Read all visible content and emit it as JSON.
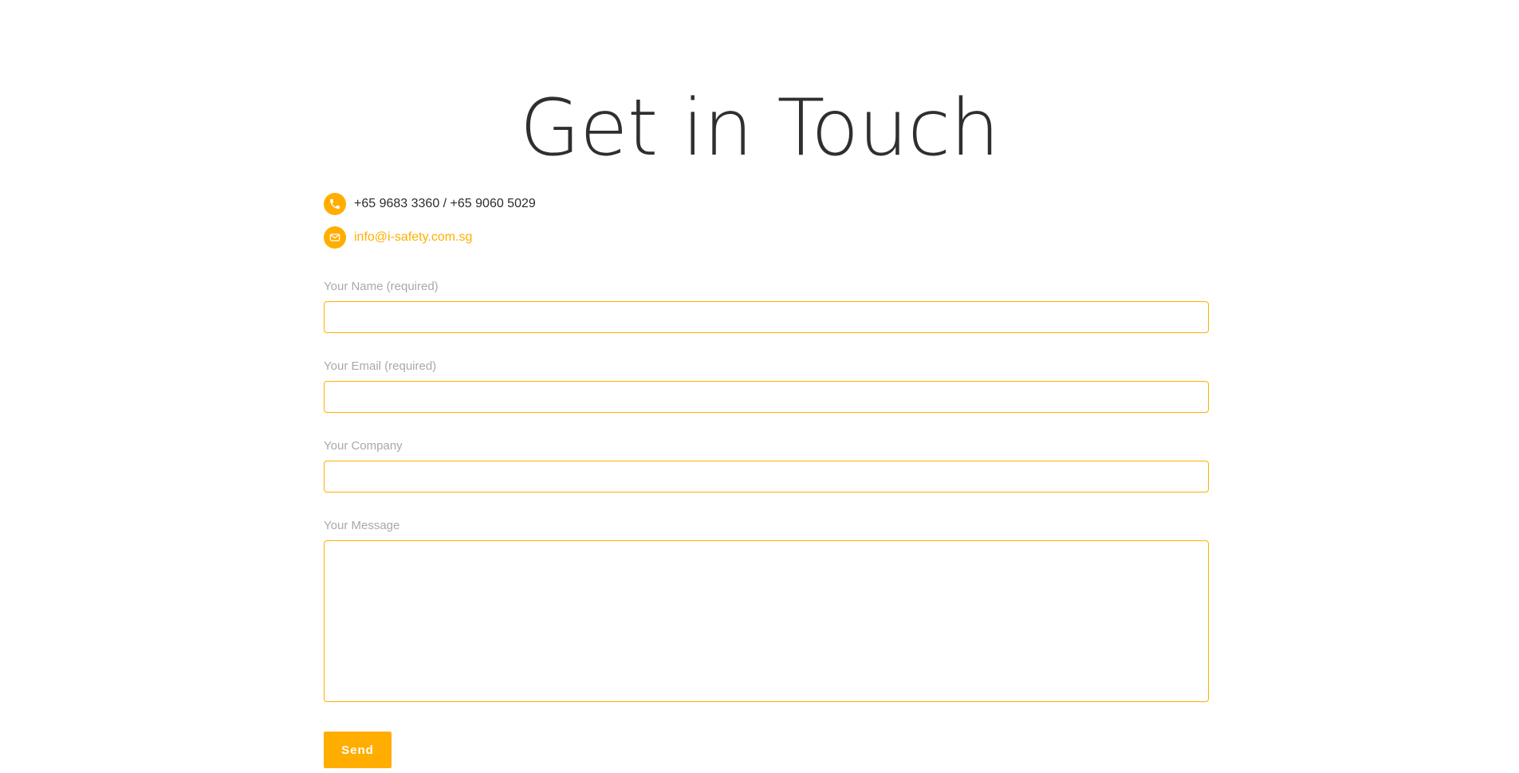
{
  "page": {
    "title": "Get in Touch"
  },
  "contact": {
    "phone": {
      "icon": "phone-icon",
      "text": "+65 9683 3360 / +65 9060 5029"
    },
    "email": {
      "icon": "envelope-icon",
      "text": "info@i-safety.com.sg"
    }
  },
  "form": {
    "fields": [
      {
        "label": "Your Name (required)",
        "value": "",
        "placeholder": ""
      },
      {
        "label": "Your Email (required)",
        "value": "",
        "placeholder": ""
      },
      {
        "label": "Your Company",
        "value": "",
        "placeholder": ""
      },
      {
        "label": "Your Message",
        "value": "",
        "placeholder": ""
      }
    ],
    "submit_label": "Send"
  },
  "colors": {
    "accent": "#ffae00",
    "title_text": "#2f2f2f",
    "label_text": "#a9a9a9",
    "background": "#ffffff"
  }
}
